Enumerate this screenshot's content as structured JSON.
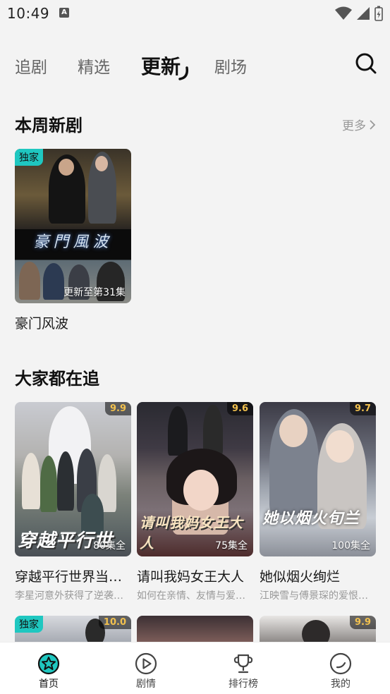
{
  "status_bar": {
    "time": "10:49",
    "notification_icon": "A"
  },
  "tabs": [
    {
      "label": "追剧",
      "active": false
    },
    {
      "label": "精选",
      "active": false
    },
    {
      "label": "更新",
      "active": true
    },
    {
      "label": "剧场",
      "active": false
    }
  ],
  "weekly_new": {
    "title": "本周新剧",
    "more_label": "更多",
    "items": [
      {
        "title": "豪门风波",
        "badge": "独家",
        "episodes": "更新至第31集",
        "poster_text": "豪門風波"
      }
    ]
  },
  "popular": {
    "title": "大家都在追",
    "items": [
      {
        "title": "穿越平行世界当…",
        "desc": "李星河意外获得了逆袭…",
        "score": "9.9",
        "episodes": "80集全",
        "poster_text": "穿越平行世"
      },
      {
        "title": "请叫我妈女王大人",
        "desc": "如何在亲情、友情与爱…",
        "score": "9.6",
        "episodes": "75集全",
        "poster_text": "请叫我妈女王大人"
      },
      {
        "title": "她似烟火绚烂",
        "desc": "江映雪与傅景琛的爱恨…",
        "score": "9.7",
        "episodes": "100集全",
        "poster_text": "她以烟火旬兰"
      }
    ]
  },
  "next_row": [
    {
      "badge": "独家",
      "score": "10.0"
    },
    {
      "badge": "",
      "score": ""
    },
    {
      "badge": "",
      "score": "9.9"
    }
  ],
  "bottom_nav": [
    {
      "label": "首页",
      "icon": "home-star-icon",
      "active": true
    },
    {
      "label": "剧情",
      "icon": "play-circle-icon",
      "active": false
    },
    {
      "label": "排行榜",
      "icon": "trophy-icon",
      "active": false
    },
    {
      "label": "我的",
      "icon": "profile-circle-icon",
      "active": false
    }
  ],
  "colors": {
    "accent": "#1fc7c0",
    "score": "#f2c14e",
    "background": "#f3f3f3"
  }
}
